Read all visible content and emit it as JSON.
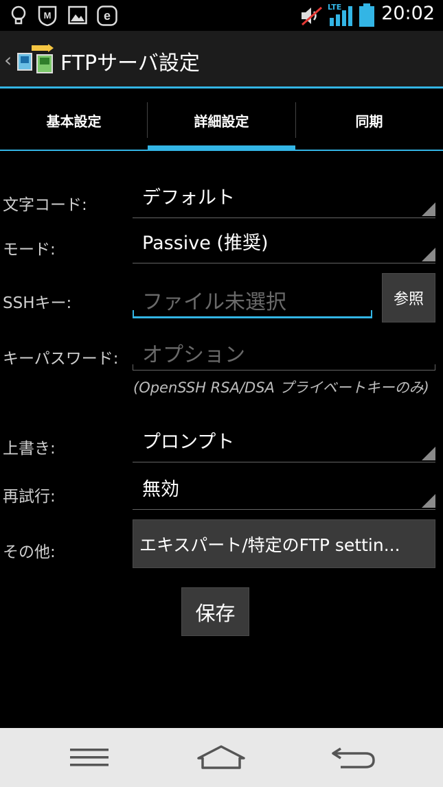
{
  "status_bar": {
    "time": "20:02",
    "network": "LTE"
  },
  "header": {
    "title": "FTPサーバ設定"
  },
  "tabs": [
    {
      "label": "基本設定"
    },
    {
      "label": "詳細設定",
      "selected": true
    },
    {
      "label": "同期"
    }
  ],
  "form": {
    "encoding": {
      "label": "文字コード:",
      "value": "デフォルト"
    },
    "mode": {
      "label": "モード:",
      "value": "Passive (推奨)"
    },
    "ssh_key": {
      "label": "SSHキー:",
      "placeholder": "ファイル未選択",
      "browse_label": "参照"
    },
    "key_password": {
      "label": "キーパスワード:",
      "placeholder": "オプション"
    },
    "hint": "(OpenSSH RSA/DSA プライベートキーのみ)",
    "overwrite": {
      "label": "上書き:",
      "value": "プロンプト"
    },
    "retry": {
      "label": "再試行:",
      "value": "無効"
    },
    "other": {
      "label": "その他:",
      "button_label": "エキスパート/特定のFTP settin..."
    },
    "save_label": "保存"
  },
  "colors": {
    "accent": "#33b5e5",
    "background": "#000000",
    "nav_bar": "#e8e8e8"
  },
  "nav": {
    "icons": [
      "menu-icon",
      "home-icon",
      "back-icon"
    ]
  }
}
